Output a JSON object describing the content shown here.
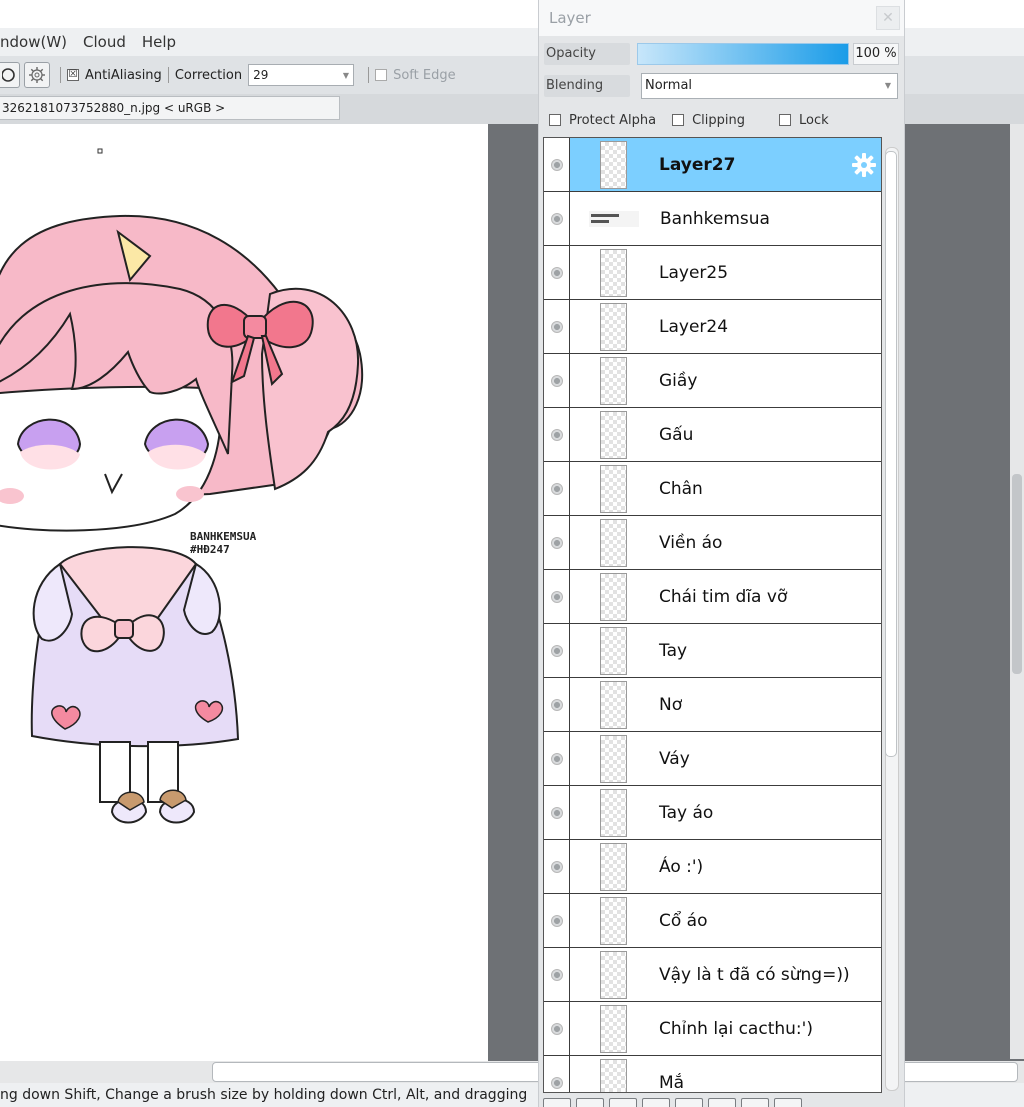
{
  "menu": {
    "items": [
      "ndow(W)",
      "Cloud",
      "Help"
    ]
  },
  "toolbar": {
    "antialiasing_label": "AntiAliasing",
    "antialiasing_checked": true,
    "correction_label": "Correction",
    "correction_value": "29",
    "soft_edge_label": "Soft Edge",
    "soft_edge_enabled": false
  },
  "document": {
    "tab_title": "3262181073752880_n.jpg < uRGB >"
  },
  "artwork": {
    "watermark_line1": "BANHKEMSUA",
    "watermark_line2": "#HĐ247"
  },
  "status": {
    "hint": "ng down Shift, Change a brush size by holding down Ctrl, Alt, and dragging"
  },
  "layer_panel": {
    "title": "Layer",
    "close_icon": "close-icon",
    "opacity_label": "Opacity",
    "opacity_value": "100 %",
    "opacity_fraction": 1.0,
    "blending_label": "Blending",
    "blending_value": "Normal",
    "options": [
      {
        "label": "Protect Alpha",
        "checked": false
      },
      {
        "label": "Clipping",
        "checked": false
      },
      {
        "label": "Lock",
        "checked": false
      }
    ],
    "layers": [
      {
        "name": "Layer27",
        "selected": true,
        "thumb": "blank"
      },
      {
        "name": "Banhkemsua",
        "selected": false,
        "thumb": "text"
      },
      {
        "name": "Layer25",
        "selected": false,
        "thumb": "blank"
      },
      {
        "name": "Layer24",
        "selected": false,
        "thumb": "blank"
      },
      {
        "name": "Giầy",
        "selected": false,
        "thumb": "blank"
      },
      {
        "name": "Gấu",
        "selected": false,
        "thumb": "blank"
      },
      {
        "name": "Chân",
        "selected": false,
        "thumb": "blank"
      },
      {
        "name": "Viền áo",
        "selected": false,
        "thumb": "blank"
      },
      {
        "name": "Chái tim dĩa vỡ",
        "selected": false,
        "thumb": "blank"
      },
      {
        "name": "Tay",
        "selected": false,
        "thumb": "blank"
      },
      {
        "name": "Nơ",
        "selected": false,
        "thumb": "blank"
      },
      {
        "name": "Váy",
        "selected": false,
        "thumb": "blank"
      },
      {
        "name": "Tay áo",
        "selected": false,
        "thumb": "blank"
      },
      {
        "name": "Áo :')",
        "selected": false,
        "thumb": "blank"
      },
      {
        "name": "Cổ áo",
        "selected": false,
        "thumb": "blank"
      },
      {
        "name": "Vậy là t đã có sừng=))",
        "selected": false,
        "thumb": "blank"
      },
      {
        "name": "Chỉnh lại cacthu:')",
        "selected": false,
        "thumb": "blank"
      },
      {
        "name": "Mắ",
        "selected": false,
        "thumb": "blank"
      }
    ]
  },
  "colors": {
    "selected_layer": "#7ccfff",
    "canvas_gray": "#6e7175",
    "hair_pink": "#f7b9c8",
    "eye_purple": "#c8a0f0",
    "bow_pink": "#f2778d",
    "dress_lavender": "#e6dcf7"
  }
}
